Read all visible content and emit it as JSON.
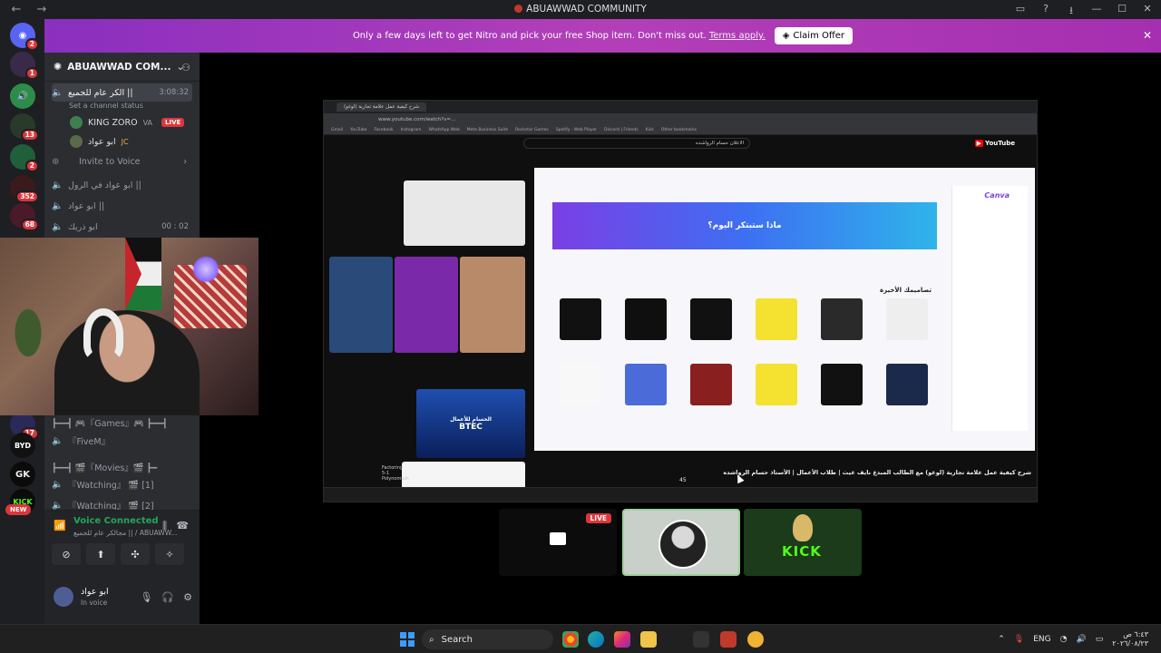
{
  "window": {
    "title": "ABUAWWAD COMMUNITY",
    "brand_color": "#5865f2"
  },
  "nitro": {
    "message": "Only a few days left to get Nitro and pick your free Shop item. Don't miss out.",
    "link": "Terms apply.",
    "button": "Claim Offer"
  },
  "guilds": [
    {
      "label": "2",
      "color": "#5865f2"
    },
    {
      "label": "1",
      "color": "#3a2a4a"
    },
    {
      "label": "",
      "color": "#2d8c4a"
    },
    {
      "label": "13",
      "color": "#2a3a2a"
    },
    {
      "label": "2",
      "color": "#1f5f3a"
    },
    {
      "label": "352",
      "color": "#3a1a1a"
    },
    {
      "label": "68",
      "color": "#4a1a2a"
    },
    {
      "label": "17",
      "color": "#2a2a5a"
    },
    {
      "label": "",
      "color": "#111"
    },
    {
      "label": "",
      "color": "#0b3a0b"
    },
    {
      "label": "",
      "color": "#0b0b0b"
    }
  ],
  "guild_text": {
    "byd": "BYD",
    "gk": "GK",
    "kick": "KICK",
    "new_badge": "NEW"
  },
  "server": {
    "name": "ABUAWWAD COM...",
    "channels": {
      "active": {
        "name": "الكر عام للجميع ||",
        "time": "3:08:32",
        "status": "Set a channel status"
      },
      "users": [
        {
          "name": "KING ZORO",
          "badge": "VA",
          "live": "LIVE"
        },
        {
          "name": "ابو عواد",
          "badge": "JC"
        }
      ],
      "invite": "Invite to Voice",
      "c2": "ابو عواد في الرول ||",
      "c3": "ابو عواد ||",
      "c4": "ابو ذريك",
      "c4_time": "00 : 02",
      "games": "┣━━┫ 🎮『Games』🎮 ┣━━┫",
      "fivem": "『FiveM』",
      "movies": "┣━━┫ 🎬『Movies』🎬 ┣━",
      "watching1": "『Watching』 🎬 [1]",
      "watching2": "『Watching』 🎬 [2]"
    }
  },
  "voice": {
    "title": "Voice Connected",
    "subtitle": "مجالكر عام للجميع || / ABUAWW..."
  },
  "user": {
    "name": "ابو عواد",
    "status": "In voice"
  },
  "stream": {
    "browser_tab": "شرح كيفية عمل علامة تجارية (لوغو)",
    "url": "www.youtube.com/watch?v=...",
    "bookmarks": [
      "Gmail",
      "YouTube",
      "Facebook",
      "Instagram",
      "WhatsApp Web",
      "Meta Business Suite",
      "Rockstar Games",
      "Spotify - Web Player",
      "Discord | Friends",
      "Kick",
      "Other bookmarks"
    ],
    "yt_search": "الاعلان حسام الرواشده",
    "yt_logo": "YouTube",
    "canva_heading": "ماذا ستبتكر اليوم؟",
    "canva_logo": "Canva",
    "canva_recent": "تصاميمك الأخيرة",
    "video_title": "شرح كيفية عمل علامة تجارية (لوغو) مع الطالب المبدع نايف غيث | طلاب الأعمال | الأستاذ حسام الرواشده",
    "side_video": "BTEC",
    "side_video2": "الحسام للأعمال",
    "factoring": "Factoring 5-1 Polynomials",
    "likes": "45"
  },
  "tiles": {
    "live": "LIVE",
    "kick_text": "KICK"
  },
  "taskbar": {
    "search": "Search",
    "lang": "ENG",
    "clock_time": "٦:٤٣ ص",
    "clock_date": "٢٠٢٦/٠٨/٢٣"
  }
}
